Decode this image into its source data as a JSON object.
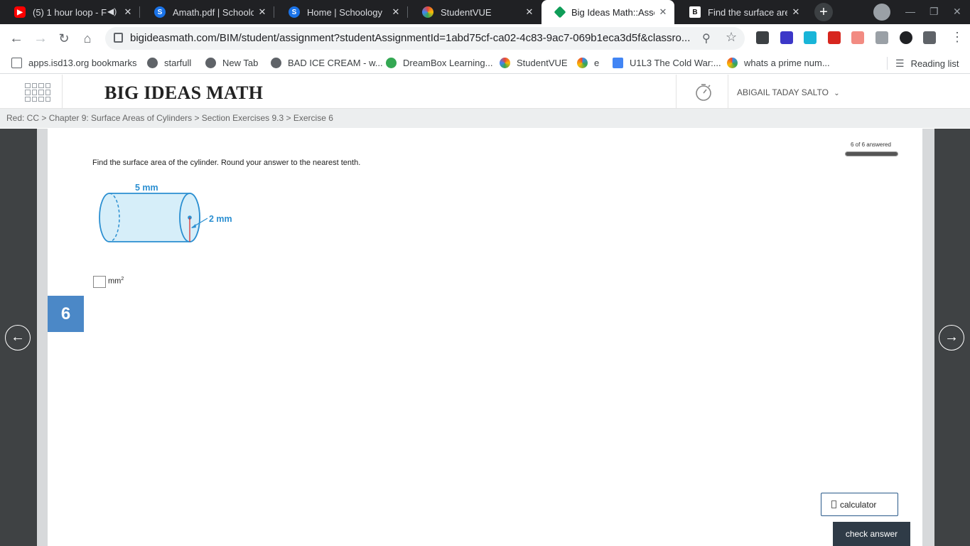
{
  "browser": {
    "tabs": [
      {
        "title": "(5) 1 hour loop - F",
        "icon": "youtube-icon",
        "color": "#ff0000"
      },
      {
        "title": "Amath.pdf | Schoolog",
        "icon": "schoology-icon",
        "color": "#1a73e8"
      },
      {
        "title": "Home | Schoology",
        "icon": "schoology-icon",
        "color": "#1a73e8"
      },
      {
        "title": "StudentVUE",
        "icon": "studentvue-icon",
        "color": "#e8453c"
      },
      {
        "title": "Big Ideas Math::Asse",
        "icon": "bigideas-icon",
        "color": "#0f9d58"
      },
      {
        "title": "Find the surface area",
        "icon": "brainly-icon",
        "color": "#111111"
      }
    ],
    "url": "bigideasmath.com/BIM/student/assignment?studentAssignmentId=1abd75cf-ca02-4c83-9ac7-069b1eca3d5f&classro...",
    "bookmarks": [
      {
        "label": "apps.isd13.org bookmarks"
      },
      {
        "label": "starfull"
      },
      {
        "label": "New Tab"
      },
      {
        "label": "BAD ICE CREAM - w..."
      },
      {
        "label": "DreamBox Learning..."
      },
      {
        "label": "StudentVUE"
      },
      {
        "label": "e"
      },
      {
        "label": "U1L3 The Cold War:..."
      },
      {
        "label": "whats a prime num..."
      }
    ],
    "reading_list": "Reading list"
  },
  "app": {
    "brand": "BIG IDEAS MATH",
    "user_name": "ABIGAIL TADAY SALTO",
    "breadcrumb": "Red: CC > Chapter 9: Surface Areas of Cylinders > Section Exercises 9.3 > Exercise 6",
    "progress_text": "6 of 6 answered",
    "progress_fraction": 1.0,
    "question": "Find the surface area of the cylinder. Round your answer to the nearest tenth.",
    "figure": {
      "height_label": "5 mm",
      "radius_label": "2 mm"
    },
    "answer": {
      "value": "",
      "unit": "mm",
      "unit_exp": "2"
    },
    "question_number": "6",
    "calculator_label": "calculator",
    "check_label": "check answer"
  },
  "colors": {
    "accent": "#4b88c7",
    "figure_stroke": "#2b8fd1",
    "figure_fill": "#d6eef9"
  }
}
